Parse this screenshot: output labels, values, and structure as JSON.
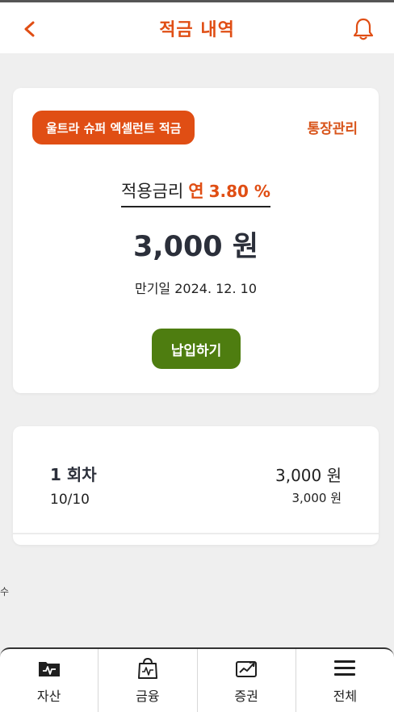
{
  "header": {
    "title": "적금 내역",
    "back_icon": "chevron-left-icon",
    "bell_icon": "bell-icon",
    "accent": "#e04e14"
  },
  "savings": {
    "product_name": "울트라 슈퍼 엑셀런트 적금",
    "manage_label": "통장관리",
    "rate_label": "적용금리",
    "rate_prefix": "연",
    "rate_value": "3.80 %",
    "amount": "3,000 원",
    "maturity_label": "만기일",
    "maturity_date": "2024. 12. 10",
    "pay_button": "납입하기",
    "pay_color": "#4e7d10"
  },
  "history": {
    "items": [
      {
        "round": "1 회차",
        "date": "10/10",
        "amount": "3,000 원",
        "sub_amount": "3,000 원"
      }
    ]
  },
  "stray_text": "수",
  "bottom_nav": {
    "items": [
      {
        "label": "자산",
        "icon": "wallet-icon"
      },
      {
        "label": "금융",
        "icon": "shopping-bag-icon"
      },
      {
        "label": "증권",
        "icon": "stock-chart-icon"
      },
      {
        "label": "전체",
        "icon": "menu-icon"
      }
    ]
  }
}
